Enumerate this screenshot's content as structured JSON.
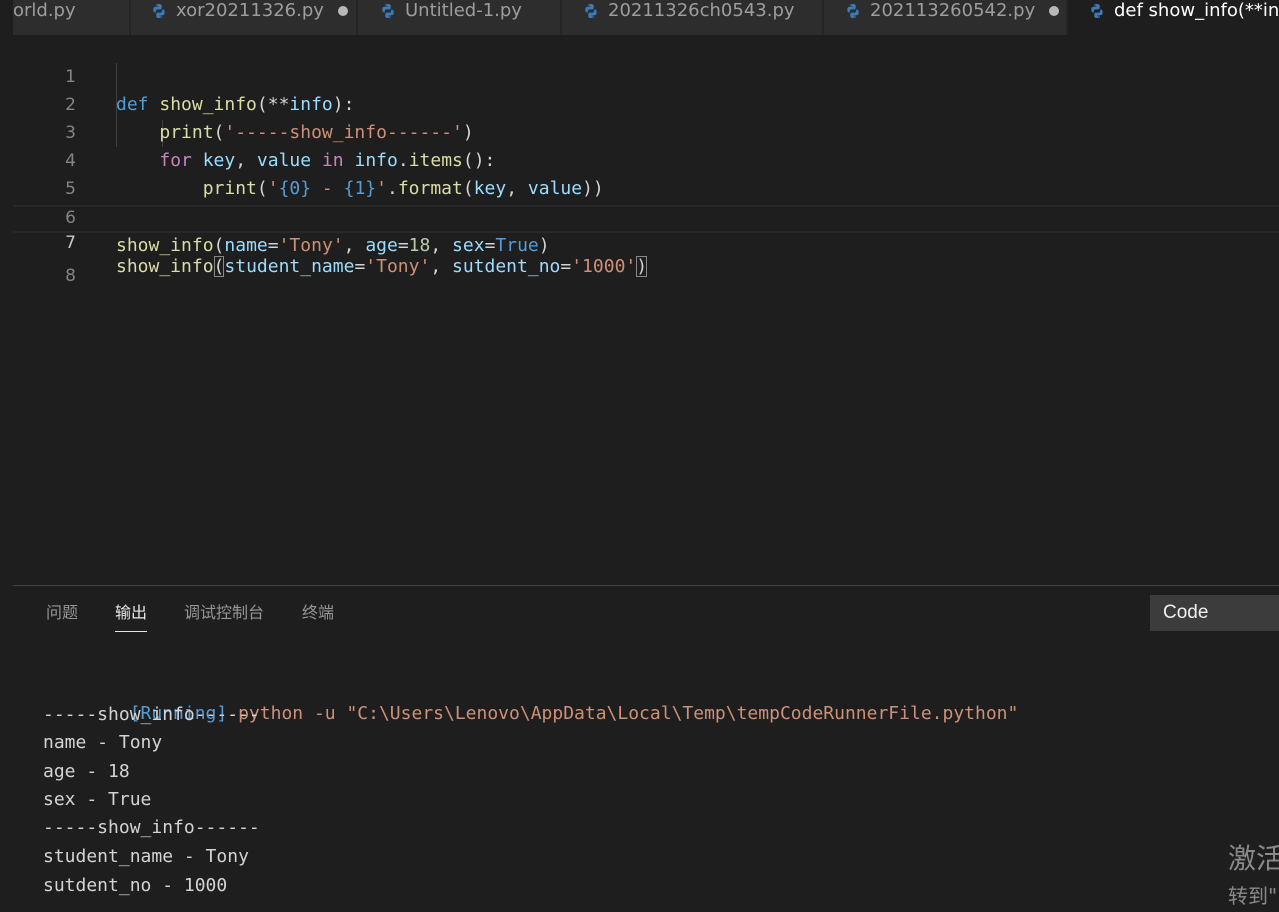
{
  "tabs": [
    {
      "label": "orld.py",
      "dirty": false,
      "active": false,
      "icon": "python-icon"
    },
    {
      "label": "xor20211326.py",
      "dirty": true,
      "active": false,
      "icon": "python-icon"
    },
    {
      "label": "Untitled-1.py",
      "dirty": false,
      "active": false,
      "icon": "python-icon"
    },
    {
      "label": "20211326ch0543.py",
      "dirty": false,
      "active": false,
      "icon": "python-icon"
    },
    {
      "label": "202113260542.py",
      "dirty": true,
      "active": false,
      "icon": "python-icon"
    },
    {
      "label": "def show_info(**inf",
      "dirty": false,
      "active": true,
      "icon": "python-icon"
    }
  ],
  "editor": {
    "line_numbers": [
      "1",
      "2",
      "3",
      "4",
      "5",
      "6",
      "7",
      "8"
    ],
    "current_line": "7",
    "lines": [
      "def show_info(**info):",
      "    print('-----show_info------')",
      "    for key, value in info.items():",
      "        print('{0} - {1}'.format(key, value))",
      "",
      "show_info(name='Tony', age=18, sex=True)",
      "show_info(student_name='Tony', sutdent_no='1000')",
      ""
    ]
  },
  "panel": {
    "tabs": [
      "问题",
      "输出",
      "调试控制台",
      "终端"
    ],
    "active_tab": "输出",
    "channel": "Code",
    "output": {
      "running_tag": "[Running]",
      "command": "python -u \"C:\\Users\\Lenovo\\AppData\\Local\\Temp\\tempCodeRunnerFile.python\"",
      "lines": [
        "-----show_info------",
        "name - Tony",
        "age - 18",
        "sex - True",
        "-----show_info------",
        "student_name - Tony",
        "sutdent_no - 1000"
      ]
    }
  },
  "watermark": {
    "line1": "激活",
    "line2": "转到\""
  },
  "colors": {
    "keyword": "#569cd6",
    "control": "#c586c0",
    "function": "#dcdcaa",
    "string": "#ce9178",
    "number": "#b5cea8",
    "variable": "#9cdcfe"
  }
}
